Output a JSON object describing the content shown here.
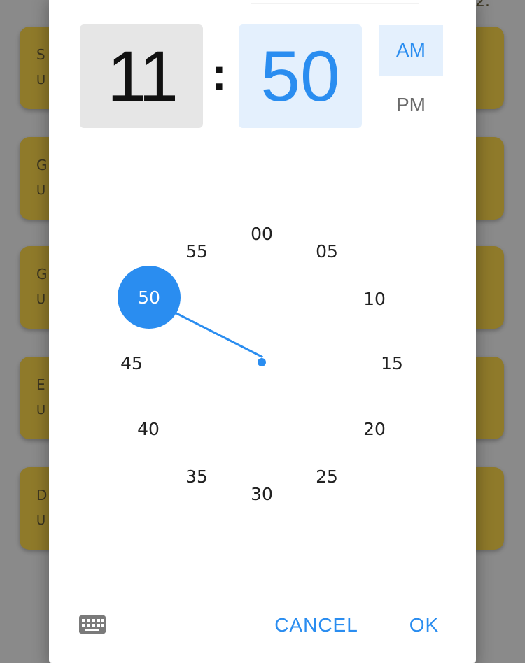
{
  "time_picker": {
    "hour": "11",
    "separator": ":",
    "minute": "50",
    "am_label": "AM",
    "pm_label": "PM",
    "selected_period": "AM"
  },
  "clock_face": {
    "minute_labels": [
      "00",
      "05",
      "10",
      "15",
      "20",
      "25",
      "30",
      "35",
      "40",
      "45",
      "50",
      "55"
    ],
    "selected_minute": "50"
  },
  "footer": {
    "keyboard_icon": "keyboard-icon",
    "cancel_label": "CANCEL",
    "ok_label": "OK"
  },
  "background": {
    "card_initials": [
      "S",
      "G",
      "G",
      "E",
      "D"
    ],
    "card_subtext": [
      "U",
      "U",
      "U",
      "U",
      "U"
    ]
  },
  "colors": {
    "accent": "#2a8df0",
    "hour_bg": "#e6e6e6",
    "minute_bg": "#e4f0fd",
    "card_bg": "#8f7a2a"
  }
}
